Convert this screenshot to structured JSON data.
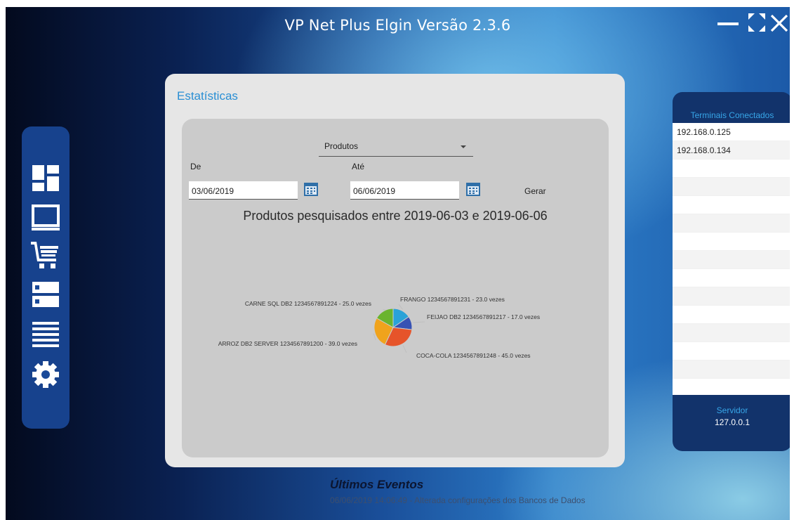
{
  "window": {
    "title": "VP Net Plus Elgin Versão 2.3.6"
  },
  "sidebar": {
    "items": [
      {
        "icon": "dashboard-icon"
      },
      {
        "icon": "monitor-icon"
      },
      {
        "icon": "cart-icon"
      },
      {
        "icon": "server-icon"
      },
      {
        "icon": "list-icon"
      },
      {
        "icon": "gear-icon"
      }
    ]
  },
  "stats": {
    "title": "Estatísticas",
    "dropdown_value": "Produtos",
    "from_label": "De",
    "to_label": "Até",
    "from_value": "03/06/2019",
    "to_value": "06/06/2019",
    "gerar_label": "Gerar",
    "chart_title": "Produtos pesquisados entre 2019-06-03 e 2019-06-06"
  },
  "chart_data": {
    "type": "pie",
    "title": "Produtos pesquisados entre 2019-06-03 e 2019-06-06",
    "slices": [
      {
        "label": "FRANGO 1234567891231 - 23.0 vezes",
        "value": 23.0,
        "color": "#2aa2d8"
      },
      {
        "label": "FEIJAO DB2 1234567891217 - 17.0 vezes",
        "value": 17.0,
        "color": "#3752b4"
      },
      {
        "label": "COCA-COLA 1234567891248 - 45.0 vezes",
        "value": 45.0,
        "color": "#e6542a"
      },
      {
        "label": "ARROZ DB2 SERVER 1234567891200 - 39.0 vezes",
        "value": 39.0,
        "color": "#f0a31c"
      },
      {
        "label": "CARNE SQL DB2 1234567891224 - 25.0 vezes",
        "value": 25.0,
        "color": "#6ab42e"
      }
    ]
  },
  "terminals": {
    "title": "Terminais Conectados",
    "items": [
      "192.168.0.125",
      "192.168.0.134"
    ],
    "server_label": "Servidor",
    "server_value": "127.0.0.1"
  },
  "events": {
    "title": "Últimos Eventos",
    "last": "06/06/2019 14:06:49 - Alterada configurações dos Bancos de Dados"
  }
}
